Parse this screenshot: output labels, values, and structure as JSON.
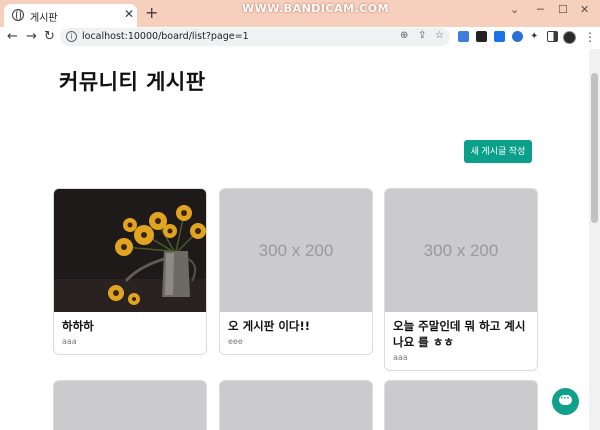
{
  "browser": {
    "tab_title": "게시판",
    "tab_close": "✕",
    "new_tab": "+",
    "watermark": "WWW.BANDICAM.COM",
    "window_controls": [
      "⌄",
      "─",
      "☐",
      "✕"
    ],
    "nav": {
      "back": "←",
      "forward": "→",
      "reload": "↻"
    },
    "url": "localhost:10000/board/list?page=1",
    "omnibox_icons": [
      "⊕",
      "⇪",
      "☆"
    ],
    "extension_colors": [
      "#3b7dd8",
      "#222222",
      "#1a73e8",
      "#3c3c3c",
      "#3c3c3c",
      "#3c3c3c"
    ],
    "kebab": "⋮"
  },
  "page": {
    "title": "커뮤니티 게시판",
    "write_button": "새 게시글 작성"
  },
  "posts": [
    {
      "title": "하하하",
      "author": "aaa",
      "image": "photo",
      "placeholder": ""
    },
    {
      "title": "오 게시판 이다!!",
      "author": "eee",
      "image": "placeholder",
      "placeholder": "300 x 200"
    },
    {
      "title": "오늘 주말인데 뭐 하고 계시나요 를 ㅎㅎ",
      "author": "aaa",
      "image": "placeholder",
      "placeholder": "300 x 200"
    }
  ],
  "colors": {
    "accent": "#0aa08a",
    "tabstrip": "#f7cfbd",
    "placeholder_bg": "#cbcacc"
  }
}
